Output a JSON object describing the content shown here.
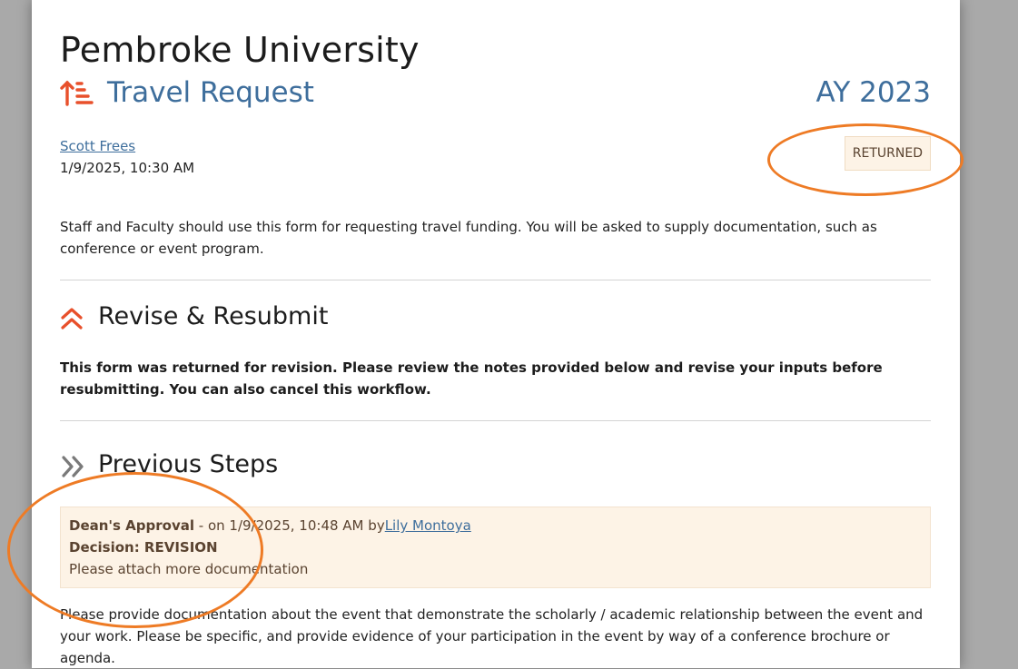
{
  "header": {
    "university": "Pembroke University",
    "form_title": "Travel Request",
    "academic_year": "AY 2023"
  },
  "submission": {
    "author": "Scott Frees",
    "datetime": "1/9/2025, 10:30 AM",
    "status": "RETURNED"
  },
  "intro_text": "Staff and Faculty should use this form for requesting travel funding. You will be asked to supply documentation, such as conference or event program.",
  "revise_section": {
    "title": "Revise & Resubmit",
    "message": "This form was returned for revision. Please review the notes provided below and revise your inputs before resubmitting. You can also cancel this workflow."
  },
  "previous_steps": {
    "title": "Previous Steps",
    "steps": [
      {
        "name": "Dean's Approval",
        "on_text": " - on 1/9/2025, 10:48 AM",
        "by_text": "by",
        "by_user": "Lily Montoya",
        "decision": "Decision: REVISION",
        "note": "Please attach more documentation"
      }
    ]
  },
  "info_text": "Please provide documentation about the event that demonstrate the scholarly / academic relationship between the event and your work. Please be specific, and provide evidence of your participation in the event by way of a conference brochure or agenda.",
  "colors": {
    "accent_orange": "#e8502b",
    "link_blue": "#3e6e9c",
    "annotation_orange": "#ee7b25"
  },
  "icons": {
    "title_icon": "sort-ascending-icon",
    "revise_icon": "double-chevron-up-icon",
    "steps_icon": "double-chevron-right-icon"
  }
}
